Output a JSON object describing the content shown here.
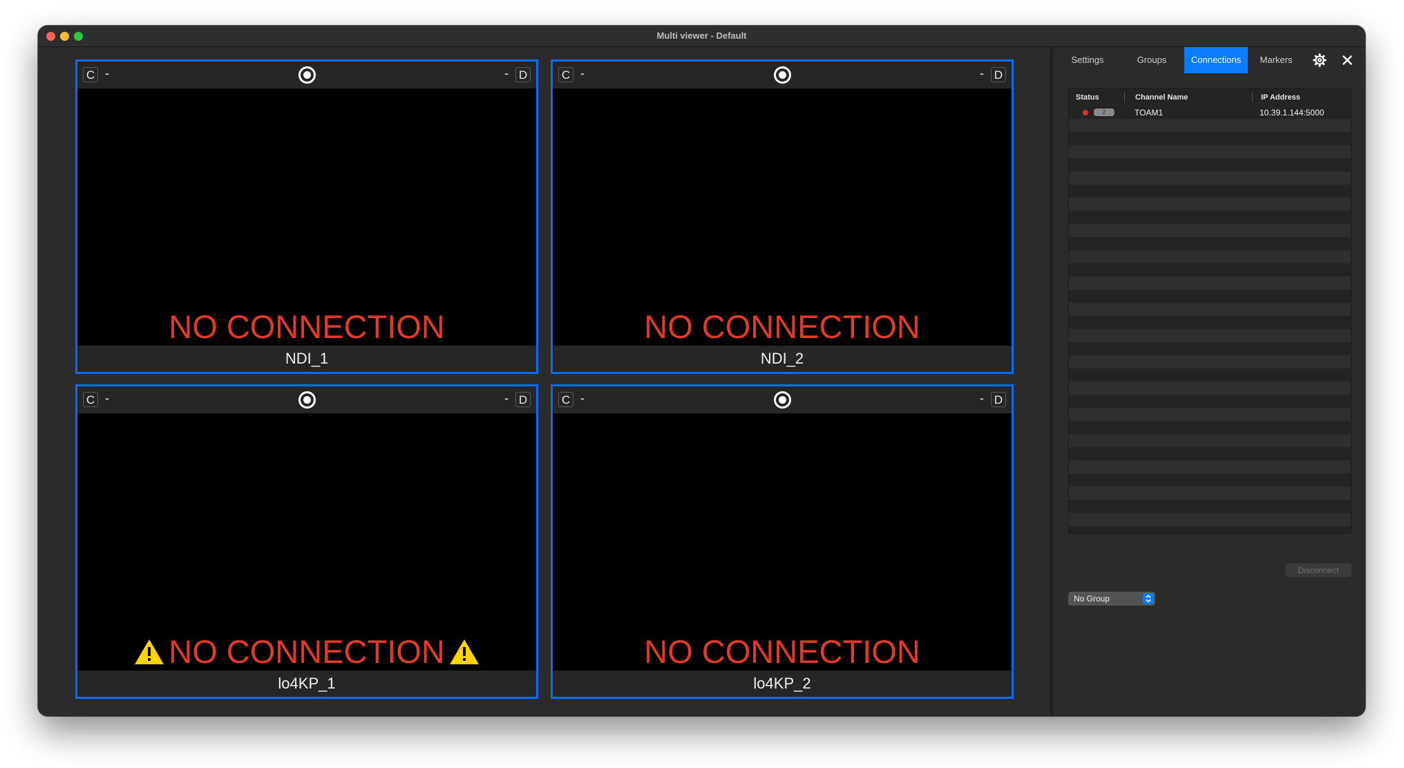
{
  "window": {
    "title": "Multi viewer - Default"
  },
  "tiles": [
    {
      "left_label": "C",
      "left_value": "-",
      "right_label": "D",
      "right_value": "-",
      "status": "NO CONNECTION",
      "name": "NDI_1",
      "warning": false
    },
    {
      "left_label": "C",
      "left_value": "-",
      "right_label": "D",
      "right_value": "-",
      "status": "NO CONNECTION",
      "name": "NDI_2",
      "warning": false
    },
    {
      "left_label": "C",
      "left_value": "-",
      "right_label": "D",
      "right_value": "-",
      "status": "NO CONNECTION",
      "name": "lo4KP_1",
      "warning": true
    },
    {
      "left_label": "C",
      "left_value": "-",
      "right_label": "D",
      "right_value": "-",
      "status": "NO CONNECTION",
      "name": "lo4KP_2",
      "warning": false
    }
  ],
  "panel": {
    "tabs": [
      "Settings",
      "Groups",
      "Connections",
      "Markers"
    ],
    "active_tab": "Connections",
    "icons": [
      "gear-icon",
      "close-icon"
    ],
    "table": {
      "headers": {
        "status": "Status",
        "channel": "Channel Name",
        "ip": "IP Address"
      },
      "rows": [
        {
          "status_color": "#e0302a",
          "badge": "2",
          "channel": "TOAM1",
          "ip": "10.39.1.144:5000"
        }
      ]
    },
    "disconnect_label": "Disconnect",
    "group_select": "No Group"
  },
  "colors": {
    "accent": "#0a7cff",
    "tile_border": "#0a6cf0",
    "no_connection": "#e23a2a",
    "warning": "#ffd400"
  }
}
